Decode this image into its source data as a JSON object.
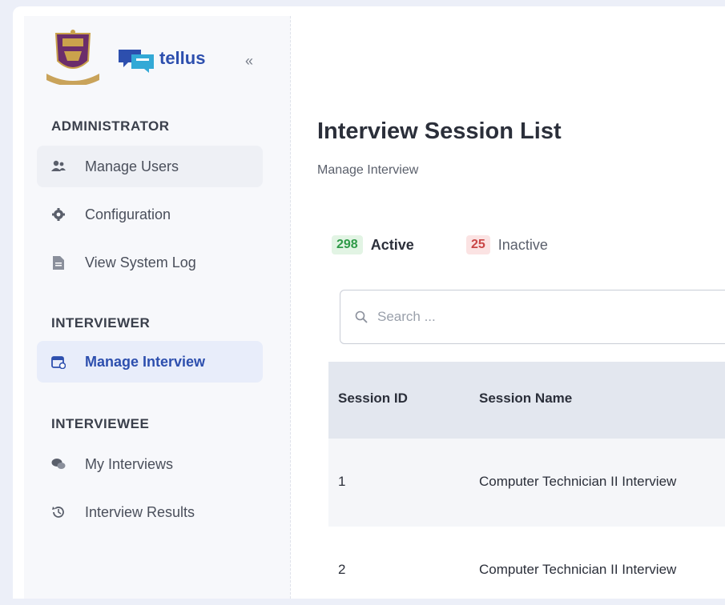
{
  "brand": {
    "name": "tellus",
    "collapse_glyph": "«",
    "crest_icon": "university-crest-icon",
    "logo_icon": "chat-bubbles-logo-icon"
  },
  "sidebar": {
    "sections": [
      {
        "title": "ADMINISTRATOR",
        "items": [
          {
            "label": "Manage Users",
            "icon": "users-icon"
          },
          {
            "label": "Configuration",
            "icon": "gear-icon"
          },
          {
            "label": "View System Log",
            "icon": "document-icon"
          }
        ]
      },
      {
        "title": "INTERVIEWER",
        "items": [
          {
            "label": "Manage Interview",
            "icon": "calendar-icon",
            "active": true
          }
        ]
      },
      {
        "title": "INTERVIEWEE",
        "items": [
          {
            "label": "My Interviews",
            "icon": "chat-icon"
          },
          {
            "label": "Interview Results",
            "icon": "history-icon"
          }
        ]
      }
    ]
  },
  "page": {
    "title": "Interview Session List",
    "breadcrumb": "Manage Interview"
  },
  "tabs": [
    {
      "count": "298",
      "label": "Active",
      "active": true
    },
    {
      "count": "25",
      "label": "Inactive",
      "active": false
    }
  ],
  "search": {
    "placeholder": "Search ..."
  },
  "table": {
    "columns": [
      "Session ID",
      "Session Name"
    ],
    "rows": [
      [
        "1",
        "Computer Technician II Interview"
      ],
      [
        "2",
        "Computer Technician II Interview"
      ]
    ]
  },
  "colors": {
    "accent": "#2d4fae",
    "active_count": "#2f9a48",
    "inactive_count": "#c94646"
  }
}
